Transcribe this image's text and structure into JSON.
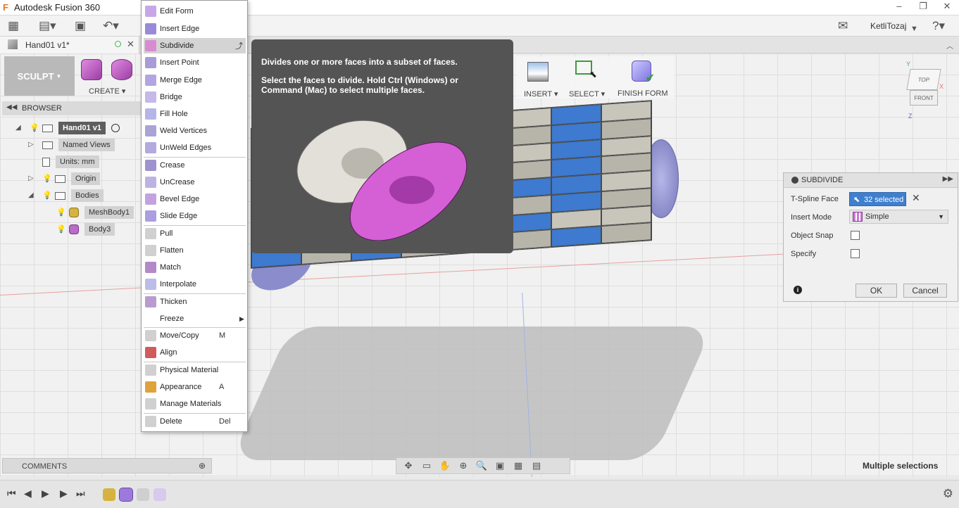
{
  "window": {
    "title": "Autodesk Fusion 360",
    "app_icon": "F",
    "user": "KetliTozaj"
  },
  "doc_tab": {
    "label": "Hand01 v1*"
  },
  "ribbon": {
    "workspace": "SCULPT",
    "create_label": "CREATE",
    "insert_label": "INSERT",
    "select_label": "SELECT",
    "finish_label": "FINISH FORM"
  },
  "browser": {
    "header": "BROWSER",
    "items": [
      {
        "label": "Hand01 v1"
      },
      {
        "label": "Named Views"
      },
      {
        "label": "Units: mm"
      },
      {
        "label": "Origin"
      },
      {
        "label": "Bodies"
      },
      {
        "label": "MeshBody1"
      },
      {
        "label": "Body3"
      }
    ]
  },
  "menu": {
    "items": [
      {
        "label": "Edit Form",
        "shortcut": ""
      },
      {
        "label": "Insert Edge",
        "shortcut": ""
      },
      {
        "label": "Subdivide",
        "shortcut": ""
      },
      {
        "label": "Insert Point",
        "shortcut": ""
      },
      {
        "label": "Merge Edge",
        "shortcut": ""
      },
      {
        "label": "Bridge",
        "shortcut": ""
      },
      {
        "label": "Fill Hole",
        "shortcut": ""
      },
      {
        "label": "Weld Vertices",
        "shortcut": ""
      },
      {
        "label": "UnWeld Edges",
        "shortcut": ""
      },
      {
        "label": "Crease",
        "shortcut": ""
      },
      {
        "label": "UnCrease",
        "shortcut": ""
      },
      {
        "label": "Bevel Edge",
        "shortcut": ""
      },
      {
        "label": "Slide Edge",
        "shortcut": ""
      },
      {
        "label": "Pull",
        "shortcut": ""
      },
      {
        "label": "Flatten",
        "shortcut": ""
      },
      {
        "label": "Match",
        "shortcut": ""
      },
      {
        "label": "Interpolate",
        "shortcut": ""
      },
      {
        "label": "Thicken",
        "shortcut": ""
      },
      {
        "label": "Freeze",
        "shortcut": ""
      },
      {
        "label": "Move/Copy",
        "shortcut": "M"
      },
      {
        "label": "Align",
        "shortcut": ""
      },
      {
        "label": "Physical Material",
        "shortcut": ""
      },
      {
        "label": "Appearance",
        "shortcut": "A"
      },
      {
        "label": "Manage Materials",
        "shortcut": ""
      },
      {
        "label": "Delete",
        "shortcut": "Del"
      }
    ]
  },
  "tooltip": {
    "summary": "Divides one or more faces into a subset of faces.",
    "detail": "Select the faces to divide. Hold Ctrl (Windows) or Command (Mac) to select multiple faces."
  },
  "dialog": {
    "title": "SUBDIVIDE",
    "tspline_label": "T-Spline Face",
    "tspline_value": "32 selected",
    "insert_mode_label": "Insert Mode",
    "insert_mode_value": "Simple",
    "object_snap_label": "Object Snap",
    "specify_label": "Specify",
    "ok_label": "OK",
    "cancel_label": "Cancel"
  },
  "viewcube": {
    "top": "TOP",
    "front": "FRONT"
  },
  "comments": {
    "label": "COMMENTS"
  },
  "status": {
    "text": "Multiple selections"
  },
  "colors": {
    "selection_blue": "#3f7fce",
    "menu_highlight": "#d4d4d4",
    "tooltip_bg": "#545454"
  }
}
